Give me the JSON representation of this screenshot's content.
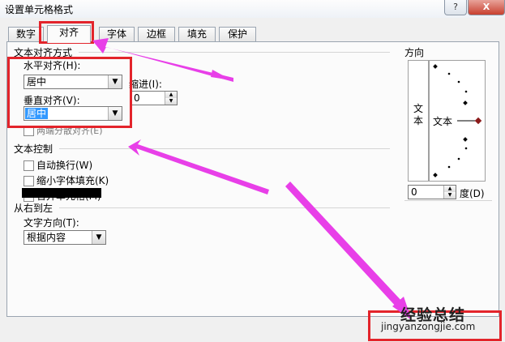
{
  "window": {
    "title": "设置单元格格式",
    "help_label": "?",
    "close_label": "X"
  },
  "tabs": [
    {
      "label": "数字"
    },
    {
      "label": "对齐"
    },
    {
      "label": "字体"
    },
    {
      "label": "边框"
    },
    {
      "label": "填充"
    },
    {
      "label": "保护"
    }
  ],
  "alignment": {
    "group_title": "文本对齐方式",
    "horizontal_label": "水平对齐(H):",
    "horizontal_value": "居中",
    "vertical_label": "垂直对齐(V):",
    "vertical_value": "居中",
    "indent_label": "缩进(I):",
    "indent_value": "0",
    "distributed_label": "两端分散对齐(E)"
  },
  "text_control": {
    "group_title": "文本控制",
    "wrap_label": "自动换行(W)",
    "shrink_label": "缩小字体填充(K)",
    "merge_label": "合并单元格(M)"
  },
  "rtl": {
    "group_title": "从右到左",
    "direction_label": "文字方向(T):",
    "direction_value": "根据内容"
  },
  "orientation": {
    "group_title": "方向",
    "vertical_text": "文本",
    "arc_text": "文本",
    "degree_value": "0",
    "degree_label": "度(D)"
  },
  "watermark": {
    "cn": "经验总结",
    "en": "jingyanzongjie.com"
  },
  "colors": {
    "annotation_red": "#e3242b",
    "arrow_magenta": "#e83fe8",
    "selection_blue": "#3399ff"
  }
}
